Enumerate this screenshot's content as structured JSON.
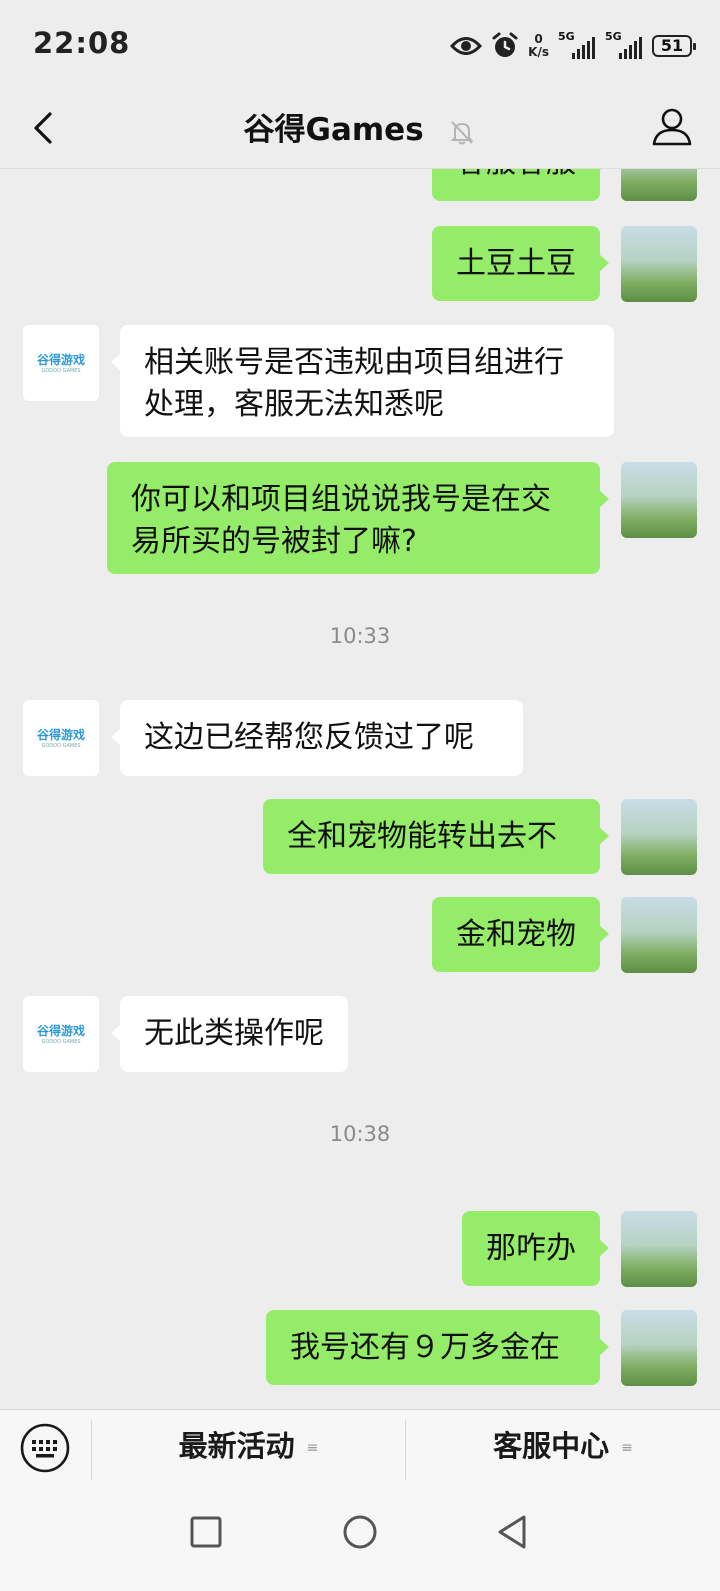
{
  "status_bar": {
    "time": "22:08",
    "net_speed_value": "0",
    "net_speed_unit": "K/s",
    "signal1_tag": "5G",
    "signal2_tag": "5G",
    "battery": "51",
    "icons": [
      "eye-icon",
      "alarm-icon",
      "signal-icon",
      "signal-icon",
      "battery-icon"
    ]
  },
  "header": {
    "title": "谷得Games",
    "icons": [
      "back-arrow-icon",
      "mute-bell-icon",
      "profile-icon"
    ]
  },
  "chat": {
    "messages": [
      {
        "from": "me",
        "text": "客服客服"
      },
      {
        "from": "me",
        "text": "土豆土豆"
      },
      {
        "from": "them",
        "text": "相关账号是否违规由项目组进行处理，客服无法知悉呢"
      },
      {
        "from": "me",
        "text": "你可以和项目组说说我号是在交易所买的号被封了嘛?"
      },
      {
        "from": "time",
        "text": "10:33"
      },
      {
        "from": "them",
        "text": "这边已经帮您反馈过了呢"
      },
      {
        "from": "me",
        "text": "全和宠物能转出去不"
      },
      {
        "from": "me",
        "text": "金和宠物"
      },
      {
        "from": "them",
        "text": "无此类操作呢"
      },
      {
        "from": "time",
        "text": "10:38"
      },
      {
        "from": "me",
        "text": "那咋办"
      },
      {
        "from": "me",
        "text": "我号还有９万多金在"
      }
    ],
    "bot_avatar_logo": "谷得游戏",
    "bot_avatar_sub": "GODOO GAMES"
  },
  "bottom_menu": {
    "item1": "最新活动",
    "item2": "客服中心",
    "icons": [
      "keyboard-icon",
      "menu-lines-icon"
    ]
  },
  "system_nav": {
    "icons": [
      "recent-apps-square-icon",
      "home-circle-icon",
      "back-triangle-icon"
    ]
  },
  "colors": {
    "background": "#ededed",
    "my_bubble": "#95ec69",
    "their_bubble": "#ffffff",
    "bottom_bar": "#f7f7f7"
  }
}
